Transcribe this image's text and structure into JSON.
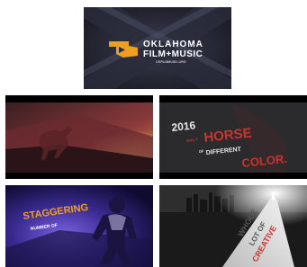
{
  "tiles": {
    "logo": {
      "line1": "OKLAHOMA",
      "line2": "FILM+MUSIC",
      "url": "OKFILMMUSIC.ORG"
    },
    "horse": {
      "year": "2016",
      "was": "WAS",
      "a": "A",
      "horse": "HORSE",
      "of": "OF",
      "different": "DIFFERENT",
      "color": "COLOR."
    },
    "staggering": {
      "word": "STAGGERING",
      "line2": "NUMBER OF"
    },
    "road": {
      "line1": "WHOLE",
      "line2": "LOT OF",
      "line3": "CREATIVE"
    }
  },
  "colors": {
    "logo_bg": "#2a2c3a",
    "orange": "#f0a020",
    "red": "#c8352e",
    "purple": "#5b3fb0"
  }
}
